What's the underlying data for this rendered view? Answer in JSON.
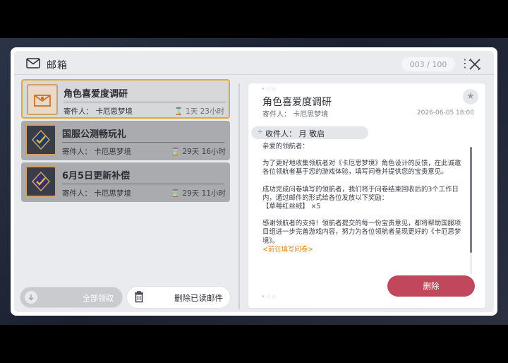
{
  "header": {
    "title": "邮箱",
    "mail_count": "003 / 100"
  },
  "mails": [
    {
      "title": "角色喜爱度调研",
      "sender": "寄件人：  卡厄思梦境",
      "time": "1天 23小时",
      "selected": true,
      "icon": "envelope-icon"
    },
    {
      "title": "国服公测畅玩礼",
      "sender": "寄件人：  卡厄思梦境",
      "time": "29天 16小时",
      "selected": false,
      "icon": "gift-emblem-icon"
    },
    {
      "title": "6月5日更新补偿",
      "sender": "寄件人：  卡厄思梦境",
      "time": "29天 11小时",
      "selected": false,
      "icon": "compensation-emblem-icon"
    }
  ],
  "buttons": {
    "claim_all": "全部领取",
    "delete_read": "删除已读邮件",
    "delete": "删除"
  },
  "detail": {
    "title": "角色喜爱度调研",
    "sender": "寄件人：  卡厄思梦境",
    "date": "2026-06-05 18:00",
    "recipient": "收件人：  月 敬启",
    "greeting": "亲爱的领航者：",
    "para1": "为了更好地收集领航者对《卡厄思梦境》角色设计的反馈，在此诚邀各位领航者基于您的游戏体验，填写问卷并提供您的宝贵意见。",
    "para2": "成功完成问卷填写的领航者，我们将于问卷结束回收后的3个工作日内，通过邮件的形式给各位发放以下奖励：",
    "reward": "【草莓红丝绒】 ×5",
    "para3": "感谢领航者的支持！领航者提交的每一份宝贵意见，都将帮助国服项目组进一步完善游戏内容，努力为各位领航者呈现更好的《卡厄思梦境》。",
    "link": "<前往填写问卷>"
  },
  "colors": {
    "accent_gold": "#e4a932",
    "delete_red": "#c1485c",
    "link_orange": "#d9851e"
  }
}
